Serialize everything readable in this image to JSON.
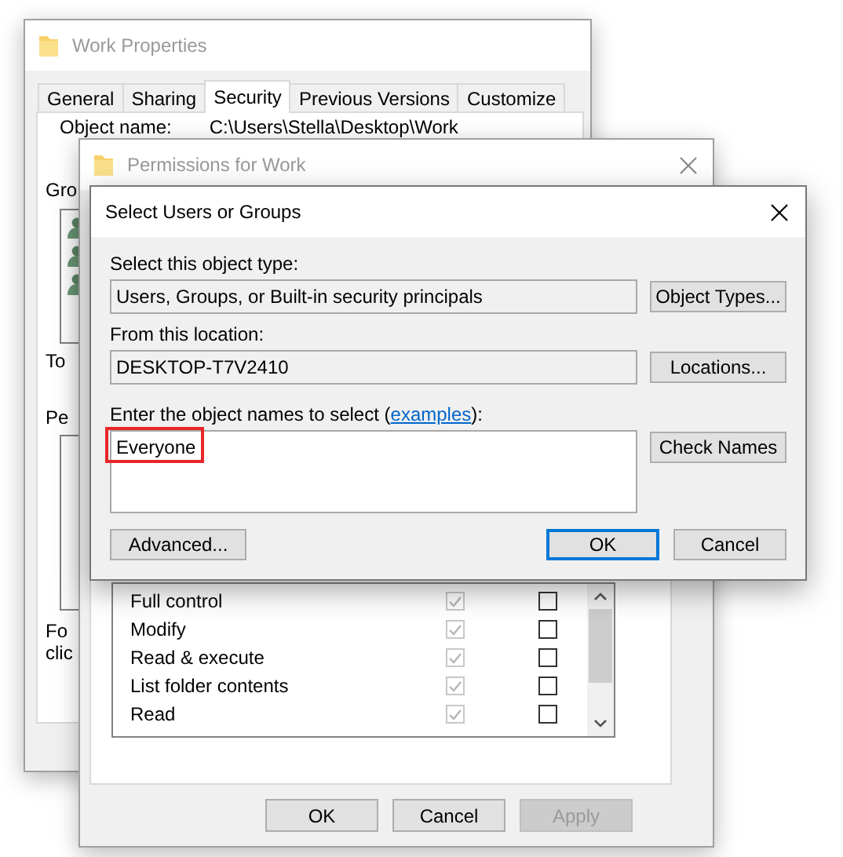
{
  "properties_window": {
    "title": "Work Properties",
    "tabs": [
      {
        "label": "General",
        "selected": false
      },
      {
        "label": "Sharing",
        "selected": false
      },
      {
        "label": "Security",
        "selected": true
      },
      {
        "label": "Previous Versions",
        "selected": false
      },
      {
        "label": "Customize",
        "selected": false
      }
    ],
    "object_name_label": "Object name:",
    "object_name": "C:\\Users\\Stella\\Desktop\\Work",
    "cut_labels": [
      "Gro",
      "To",
      "Pe",
      "Fo",
      "clic"
    ]
  },
  "permissions_window": {
    "title": "Permissions for Work",
    "permissions": [
      {
        "name": "Full control",
        "allow": {
          "checked": true,
          "disabled": true
        },
        "deny": {
          "checked": false,
          "disabled": false
        }
      },
      {
        "name": "Modify",
        "allow": {
          "checked": true,
          "disabled": true
        },
        "deny": {
          "checked": false,
          "disabled": false
        }
      },
      {
        "name": "Read & execute",
        "allow": {
          "checked": true,
          "disabled": true
        },
        "deny": {
          "checked": false,
          "disabled": false
        }
      },
      {
        "name": "List folder contents",
        "allow": {
          "checked": true,
          "disabled": true
        },
        "deny": {
          "checked": false,
          "disabled": false
        }
      },
      {
        "name": "Read",
        "allow": {
          "checked": true,
          "disabled": true
        },
        "deny": {
          "checked": false,
          "disabled": false
        }
      }
    ],
    "buttons": [
      {
        "label": "OK",
        "disabled": false
      },
      {
        "label": "Cancel",
        "disabled": false
      },
      {
        "label": "Apply",
        "disabled": true
      }
    ]
  },
  "select_dialog": {
    "title": "Select Users or Groups",
    "object_type_label": "Select this object type:",
    "object_type": "Users, Groups, or Built-in security principals",
    "object_types_button": "Object Types...",
    "location_label": "From this location:",
    "location": "DESKTOP-T7V2410",
    "locations_button": "Locations...",
    "names_label": {
      "before": "Enter the object names to select (",
      "link": "examples",
      "after": "):"
    },
    "names_value": "Everyone",
    "names_highlighted": true,
    "check_names_button": "Check Names",
    "advanced_button": "Advanced...",
    "buttons": [
      {
        "label": "OK",
        "default": true
      },
      {
        "label": "Cancel",
        "default": false
      }
    ]
  }
}
